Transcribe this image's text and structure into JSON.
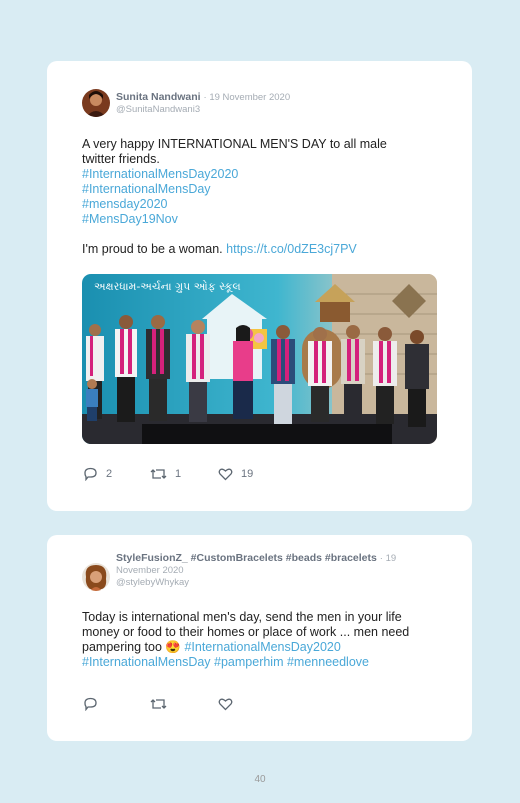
{
  "tweets": [
    {
      "author": "Sunita Nandwani",
      "date": "· 19 November 2020",
      "handle": "@SunitaNandwani3",
      "text_line1": "A very happy INTERNATIONAL MEN'S DAY to all male",
      "text_line2": "twitter friends.",
      "hashtags": [
        "#InternationalMensDay2020",
        "#InternationalMensDay",
        "#mensday2020",
        "#MensDay19Nov"
      ],
      "proud_text": "I'm proud to be a woman. ",
      "link": "https://t.co/0dZE3cj7PV",
      "banner_text": "અક્ષરધામ-અર્ચના ગ્રુપ ઓફ સ્કૂલ",
      "replies": "2",
      "retweets": "1",
      "likes": "19"
    },
    {
      "author": "StyleFusionZ_ #CustomBracelets #beads #bracelets",
      "date_part1": "· 19",
      "date_part2": "November 2020",
      "handle": "@stylebyWhykay",
      "text_line1": "Today is international men's day, send the men in your life",
      "text_line2": "money or food to their homes or place of work ... men need",
      "text_line3_prefix": "pampering too ",
      "emoji": "😍",
      "hashtag_inline": " #InternationalMensDay2020",
      "hashtags_line4": "#InternationalMensDay #pamperhim #menneedlove",
      "replies": "",
      "retweets": "",
      "likes": ""
    }
  ],
  "page_number": "40",
  "colors": {
    "background": "#d9ecf3",
    "hashtag": "#4aa8d8",
    "card": "#ffffff"
  },
  "icons": [
    "reply-icon",
    "retweet-icon",
    "like-icon"
  ]
}
